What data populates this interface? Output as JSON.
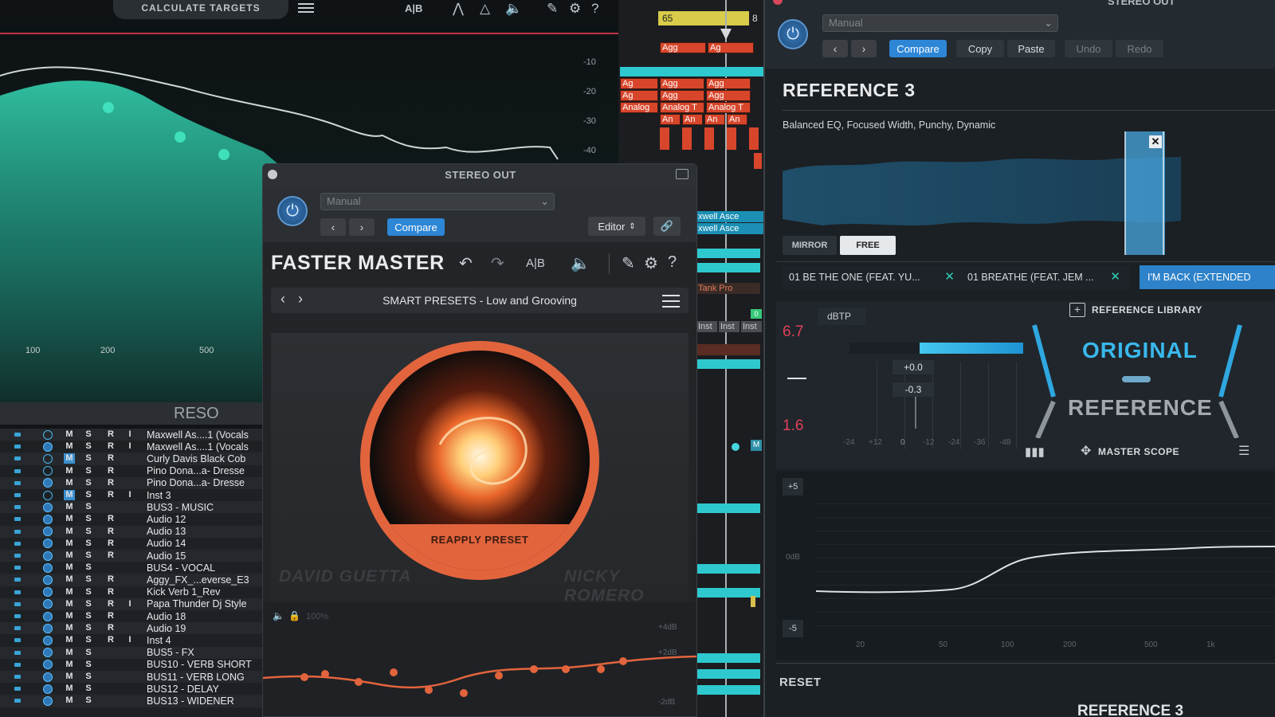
{
  "eq_panel": {
    "calc_label": "CALCULATE TARGETS",
    "db_labels": [
      "-10",
      "-20",
      "-30",
      "-40"
    ],
    "freq_labels": [
      "100",
      "200",
      "500"
    ],
    "reso_label": "RESO",
    "icons": [
      "ab-compare-icon",
      "filter-icon",
      "triangle-icon",
      "mute-icon",
      "brush-icon",
      "gear-icon",
      "help-icon"
    ]
  },
  "tracks": [
    {
      "name": "Maxwell As....1 (Vocals",
      "m_on": false,
      "rec": true,
      "inp": true,
      "pw_on": false
    },
    {
      "name": "Maxwell As....1 (Vocals",
      "m_on": false,
      "rec": true,
      "inp": true,
      "pw_on": true
    },
    {
      "name": "Curly Davis Black Cob",
      "m_on": true,
      "rec": true,
      "inp": false,
      "pw_on": false
    },
    {
      "name": "Pino Dona...a- Dresse",
      "m_on": false,
      "rec": true,
      "inp": false,
      "pw_on": false
    },
    {
      "name": "Pino Dona...a- Dresse",
      "m_on": false,
      "rec": true,
      "inp": false,
      "pw_on": true
    },
    {
      "name": "Inst 3",
      "m_on": true,
      "rec": true,
      "inp": true,
      "pw_on": false
    },
    {
      "name": "BUS3 - MUSIC",
      "m_on": false,
      "rec": false,
      "inp": false,
      "pw_on": true
    },
    {
      "name": "Audio 12",
      "m_on": false,
      "rec": true,
      "inp": false,
      "pw_on": true
    },
    {
      "name": "Audio 13",
      "m_on": false,
      "rec": true,
      "inp": false,
      "pw_on": true
    },
    {
      "name": "Audio 14",
      "m_on": false,
      "rec": true,
      "inp": false,
      "pw_on": true
    },
    {
      "name": "Audio 15",
      "m_on": false,
      "rec": true,
      "inp": false,
      "pw_on": true
    },
    {
      "name": "BUS4 - VOCAL",
      "m_on": false,
      "rec": false,
      "inp": false,
      "pw_on": true
    },
    {
      "name": "Aggy_FX_...everse_E3",
      "m_on": false,
      "rec": true,
      "inp": false,
      "pw_on": true
    },
    {
      "name": "Kick Verb 1_Rev",
      "m_on": false,
      "rec": true,
      "inp": false,
      "pw_on": true
    },
    {
      "name": "Papa Thunder Dj Style",
      "m_on": false,
      "rec": true,
      "inp": true,
      "pw_on": true
    },
    {
      "name": "Audio 18",
      "m_on": false,
      "rec": true,
      "inp": false,
      "pw_on": true
    },
    {
      "name": "Audio 19",
      "m_on": false,
      "rec": true,
      "inp": false,
      "pw_on": true
    },
    {
      "name": "Inst 4",
      "m_on": false,
      "rec": true,
      "inp": true,
      "pw_on": true
    },
    {
      "name": "BUS5 - FX",
      "m_on": false,
      "rec": false,
      "inp": false,
      "pw_on": true
    },
    {
      "name": "BUS10 - VERB SHORT",
      "m_on": false,
      "rec": false,
      "inp": false,
      "pw_on": true
    },
    {
      "name": "BUS11 - VERB LONG",
      "m_on": false,
      "rec": false,
      "inp": false,
      "pw_on": true
    },
    {
      "name": "BUS12 - DELAY",
      "m_on": false,
      "rec": false,
      "inp": false,
      "pw_on": true
    },
    {
      "name": "BUS13 - WIDENER",
      "m_on": false,
      "rec": false,
      "inp": false,
      "pw_on": true
    }
  ],
  "track_buttons": {
    "m": "M",
    "s": "S",
    "r": "R",
    "i": "I"
  },
  "arrange": {
    "bar_65": "65",
    "bar_next": "8",
    "agg": "Agg",
    "ag": "Ag",
    "analog": "Analog",
    "analog_t": "Analog T",
    "an": "An",
    "maxwell": "xwell Asce",
    "tank": "Tank Pro",
    "inst": "Inst",
    "m_short": "M",
    "zero": "0"
  },
  "faster_master": {
    "window_title": "STEREO OUT",
    "preset_select": "Manual",
    "compare_label": "Compare",
    "editor_label": "Editor",
    "name": "FASTER MASTER",
    "smart_presets": "SMART PRESETS - Low and Grooving",
    "reapply_label": "REAPPLY PRESET",
    "ghost_left": "DAVID GUETTA",
    "ghost_right": "NICKY ROMERO",
    "mini_pct": "100%",
    "mini_db": [
      "+4dB",
      "+2dB",
      "-2dB"
    ]
  },
  "reference": {
    "window_title": "STEREO OUT",
    "preset_select": "Manual",
    "buttons": {
      "compare": "Compare",
      "copy": "Copy",
      "paste": "Paste",
      "undo": "Undo",
      "redo": "Redo"
    },
    "title": "REFERENCE 3",
    "tags": "Balanced EQ,  Focused Width,  Punchy,  Dynamic",
    "mirror_label": "MIRROR",
    "free_label": "FREE",
    "tabs": [
      "01 BE THE ONE (FEAT. YU...",
      "01 BREATHE (FEAT. JEM ...",
      "I'M BACK (EXTENDED"
    ],
    "dbtp_label": "dBTP",
    "level_top": "6.7",
    "level_bottom": "1.6",
    "meter_vals": [
      "+0.0",
      "-0.3"
    ],
    "meter_scale": [
      "-24",
      "+12",
      "0",
      "-12",
      "-24",
      "-36",
      "-48"
    ],
    "library_label": "REFERENCE LIBRARY",
    "original_label": "ORIGINAL",
    "reference_label": "REFERENCE",
    "master_scope_label": "MASTER SCOPE",
    "scope_plus": "+5",
    "scope_minus": "-5",
    "scope_0db": "0dB",
    "scope_freqs": [
      "20",
      "50",
      "100",
      "200",
      "500",
      "1k"
    ],
    "reset_label": "RESET",
    "footer_title": "REFERENCE 3",
    "accent": "#2d86d6"
  }
}
